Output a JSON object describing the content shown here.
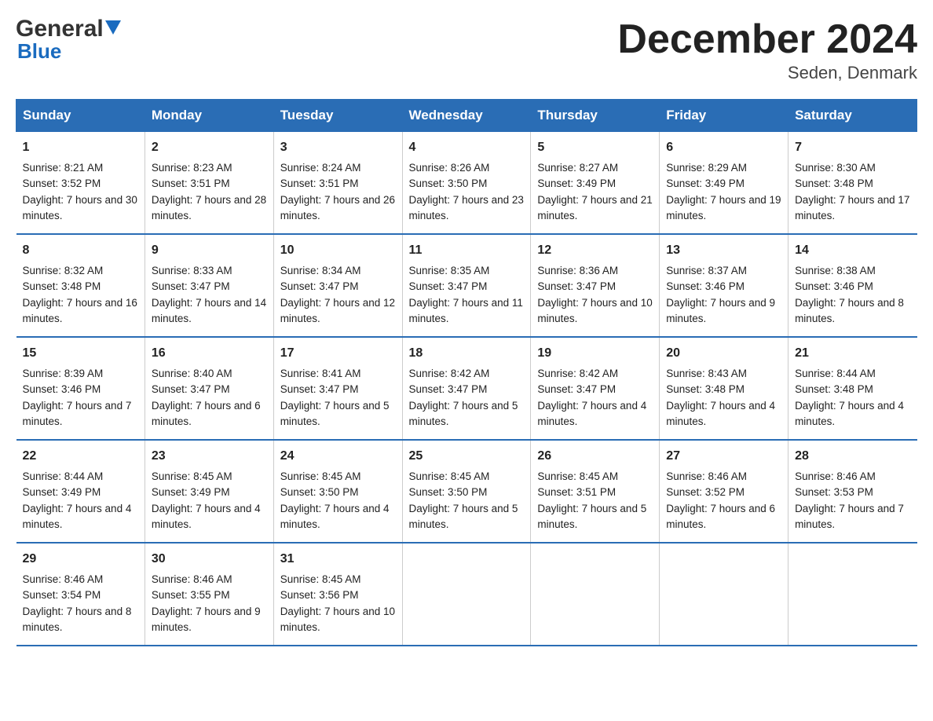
{
  "header": {
    "logo_general": "General",
    "logo_blue": "Blue",
    "month_title": "December 2024",
    "location": "Seden, Denmark"
  },
  "calendar": {
    "days_of_week": [
      "Sunday",
      "Monday",
      "Tuesday",
      "Wednesday",
      "Thursday",
      "Friday",
      "Saturday"
    ],
    "weeks": [
      [
        {
          "day": "1",
          "sunrise": "Sunrise: 8:21 AM",
          "sunset": "Sunset: 3:52 PM",
          "daylight": "Daylight: 7 hours and 30 minutes."
        },
        {
          "day": "2",
          "sunrise": "Sunrise: 8:23 AM",
          "sunset": "Sunset: 3:51 PM",
          "daylight": "Daylight: 7 hours and 28 minutes."
        },
        {
          "day": "3",
          "sunrise": "Sunrise: 8:24 AM",
          "sunset": "Sunset: 3:51 PM",
          "daylight": "Daylight: 7 hours and 26 minutes."
        },
        {
          "day": "4",
          "sunrise": "Sunrise: 8:26 AM",
          "sunset": "Sunset: 3:50 PM",
          "daylight": "Daylight: 7 hours and 23 minutes."
        },
        {
          "day": "5",
          "sunrise": "Sunrise: 8:27 AM",
          "sunset": "Sunset: 3:49 PM",
          "daylight": "Daylight: 7 hours and 21 minutes."
        },
        {
          "day": "6",
          "sunrise": "Sunrise: 8:29 AM",
          "sunset": "Sunset: 3:49 PM",
          "daylight": "Daylight: 7 hours and 19 minutes."
        },
        {
          "day": "7",
          "sunrise": "Sunrise: 8:30 AM",
          "sunset": "Sunset: 3:48 PM",
          "daylight": "Daylight: 7 hours and 17 minutes."
        }
      ],
      [
        {
          "day": "8",
          "sunrise": "Sunrise: 8:32 AM",
          "sunset": "Sunset: 3:48 PM",
          "daylight": "Daylight: 7 hours and 16 minutes."
        },
        {
          "day": "9",
          "sunrise": "Sunrise: 8:33 AM",
          "sunset": "Sunset: 3:47 PM",
          "daylight": "Daylight: 7 hours and 14 minutes."
        },
        {
          "day": "10",
          "sunrise": "Sunrise: 8:34 AM",
          "sunset": "Sunset: 3:47 PM",
          "daylight": "Daylight: 7 hours and 12 minutes."
        },
        {
          "day": "11",
          "sunrise": "Sunrise: 8:35 AM",
          "sunset": "Sunset: 3:47 PM",
          "daylight": "Daylight: 7 hours and 11 minutes."
        },
        {
          "day": "12",
          "sunrise": "Sunrise: 8:36 AM",
          "sunset": "Sunset: 3:47 PM",
          "daylight": "Daylight: 7 hours and 10 minutes."
        },
        {
          "day": "13",
          "sunrise": "Sunrise: 8:37 AM",
          "sunset": "Sunset: 3:46 PM",
          "daylight": "Daylight: 7 hours and 9 minutes."
        },
        {
          "day": "14",
          "sunrise": "Sunrise: 8:38 AM",
          "sunset": "Sunset: 3:46 PM",
          "daylight": "Daylight: 7 hours and 8 minutes."
        }
      ],
      [
        {
          "day": "15",
          "sunrise": "Sunrise: 8:39 AM",
          "sunset": "Sunset: 3:46 PM",
          "daylight": "Daylight: 7 hours and 7 minutes."
        },
        {
          "day": "16",
          "sunrise": "Sunrise: 8:40 AM",
          "sunset": "Sunset: 3:47 PM",
          "daylight": "Daylight: 7 hours and 6 minutes."
        },
        {
          "day": "17",
          "sunrise": "Sunrise: 8:41 AM",
          "sunset": "Sunset: 3:47 PM",
          "daylight": "Daylight: 7 hours and 5 minutes."
        },
        {
          "day": "18",
          "sunrise": "Sunrise: 8:42 AM",
          "sunset": "Sunset: 3:47 PM",
          "daylight": "Daylight: 7 hours and 5 minutes."
        },
        {
          "day": "19",
          "sunrise": "Sunrise: 8:42 AM",
          "sunset": "Sunset: 3:47 PM",
          "daylight": "Daylight: 7 hours and 4 minutes."
        },
        {
          "day": "20",
          "sunrise": "Sunrise: 8:43 AM",
          "sunset": "Sunset: 3:48 PM",
          "daylight": "Daylight: 7 hours and 4 minutes."
        },
        {
          "day": "21",
          "sunrise": "Sunrise: 8:44 AM",
          "sunset": "Sunset: 3:48 PM",
          "daylight": "Daylight: 7 hours and 4 minutes."
        }
      ],
      [
        {
          "day": "22",
          "sunrise": "Sunrise: 8:44 AM",
          "sunset": "Sunset: 3:49 PM",
          "daylight": "Daylight: 7 hours and 4 minutes."
        },
        {
          "day": "23",
          "sunrise": "Sunrise: 8:45 AM",
          "sunset": "Sunset: 3:49 PM",
          "daylight": "Daylight: 7 hours and 4 minutes."
        },
        {
          "day": "24",
          "sunrise": "Sunrise: 8:45 AM",
          "sunset": "Sunset: 3:50 PM",
          "daylight": "Daylight: 7 hours and 4 minutes."
        },
        {
          "day": "25",
          "sunrise": "Sunrise: 8:45 AM",
          "sunset": "Sunset: 3:50 PM",
          "daylight": "Daylight: 7 hours and 5 minutes."
        },
        {
          "day": "26",
          "sunrise": "Sunrise: 8:45 AM",
          "sunset": "Sunset: 3:51 PM",
          "daylight": "Daylight: 7 hours and 5 minutes."
        },
        {
          "day": "27",
          "sunrise": "Sunrise: 8:46 AM",
          "sunset": "Sunset: 3:52 PM",
          "daylight": "Daylight: 7 hours and 6 minutes."
        },
        {
          "day": "28",
          "sunrise": "Sunrise: 8:46 AM",
          "sunset": "Sunset: 3:53 PM",
          "daylight": "Daylight: 7 hours and 7 minutes."
        }
      ],
      [
        {
          "day": "29",
          "sunrise": "Sunrise: 8:46 AM",
          "sunset": "Sunset: 3:54 PM",
          "daylight": "Daylight: 7 hours and 8 minutes."
        },
        {
          "day": "30",
          "sunrise": "Sunrise: 8:46 AM",
          "sunset": "Sunset: 3:55 PM",
          "daylight": "Daylight: 7 hours and 9 minutes."
        },
        {
          "day": "31",
          "sunrise": "Sunrise: 8:45 AM",
          "sunset": "Sunset: 3:56 PM",
          "daylight": "Daylight: 7 hours and 10 minutes."
        },
        null,
        null,
        null,
        null
      ]
    ]
  }
}
